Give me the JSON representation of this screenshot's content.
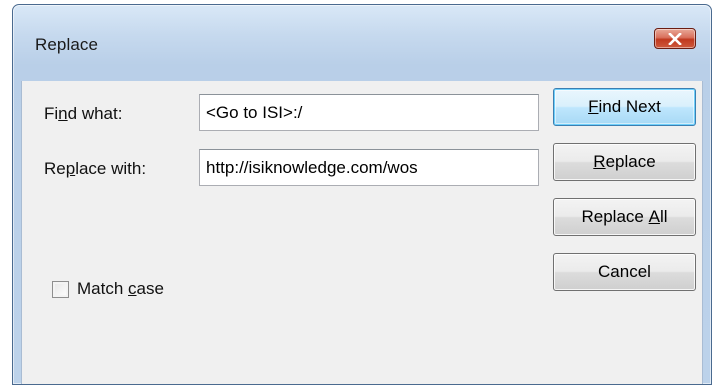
{
  "window": {
    "title": "Replace"
  },
  "fields": {
    "find_label_pre": "Fi",
    "find_label_accel": "n",
    "find_label_post": "d what:",
    "find_value": "<Go to ISI>:/",
    "replace_label_pre": "Re",
    "replace_label_accel": "p",
    "replace_label_post": "lace with:",
    "replace_value": "http://isiknowledge.com/wos"
  },
  "buttons": {
    "find_next_accel": "F",
    "find_next_rest": "ind Next",
    "replace_accel": "R",
    "replace_rest": "eplace",
    "replace_all_pre": "Replace ",
    "replace_all_accel": "A",
    "replace_all_post": "ll",
    "cancel": "Cancel"
  },
  "options": {
    "match_case_pre": "Match ",
    "match_case_accel": "c",
    "match_case_post": "ase",
    "match_case_checked": false
  },
  "colors": {
    "close_button": "#c0391f",
    "default_button_border": "#3c7fb1"
  }
}
